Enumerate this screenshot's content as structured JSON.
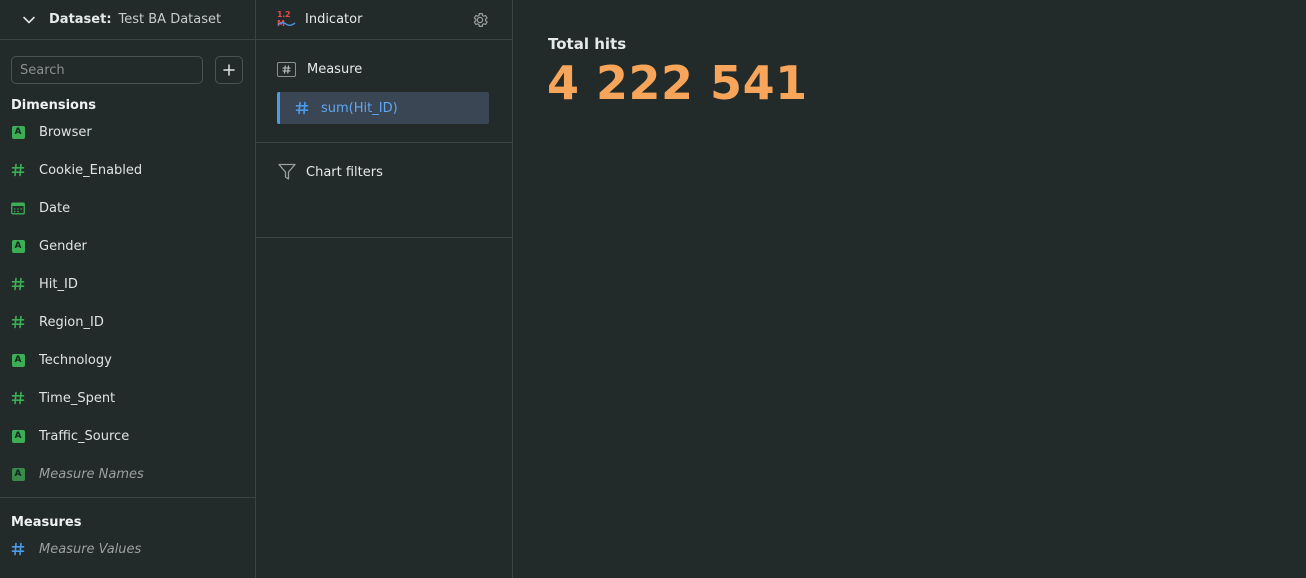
{
  "dataset": {
    "label": "Dataset:",
    "name": "Test BA Dataset"
  },
  "search": {
    "placeholder": "Search",
    "value": ""
  },
  "dimensions": {
    "title": "Dimensions",
    "items": [
      {
        "label": "Browser",
        "type": "string"
      },
      {
        "label": "Cookie_Enabled",
        "type": "number"
      },
      {
        "label": "Date",
        "type": "date"
      },
      {
        "label": "Gender",
        "type": "string"
      },
      {
        "label": "Hit_ID",
        "type": "number"
      },
      {
        "label": "Region_ID",
        "type": "number"
      },
      {
        "label": "Technology",
        "type": "string"
      },
      {
        "label": "Time_Spent",
        "type": "number"
      },
      {
        "label": "Traffic_Source",
        "type": "string"
      },
      {
        "label": "Measure Names",
        "type": "string"
      }
    ]
  },
  "measures": {
    "title": "Measures",
    "items": [
      {
        "label": "Measure Values",
        "type": "number"
      }
    ]
  },
  "visualization": {
    "icon_text": "1.2 M",
    "title": "Indicator",
    "measure_section": "Measure",
    "measure_chip": "sum(Hit_ID)",
    "filters_section": "Chart filters"
  },
  "indicator": {
    "title": "Total hits",
    "value": "4 222 541"
  },
  "colors": {
    "background": "#232a2a",
    "dimension_icon": "#3cae55",
    "measure_icon": "#4b9bea",
    "indicator_value": "#f7a55a",
    "chip_background": "#3a4654"
  }
}
